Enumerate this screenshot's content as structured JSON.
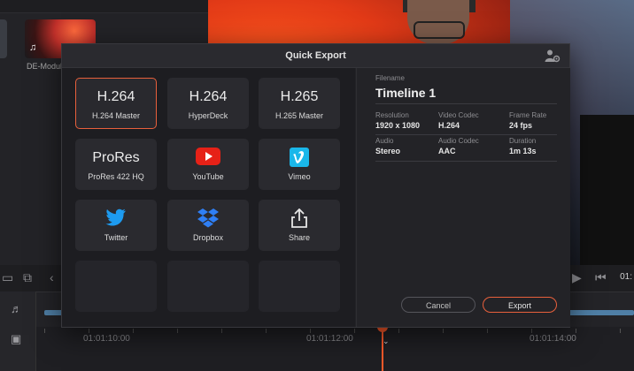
{
  "media_pool": {
    "clip_name": "DE-Modul"
  },
  "timeline": {
    "timecodes": [
      "01:01:10:00",
      "01:01:12:00",
      "01:01:14:00"
    ],
    "right_timecode": "01:"
  },
  "dialog": {
    "title": "Quick Export",
    "presets": [
      {
        "title": "H.264",
        "subtitle": "H.264 Master",
        "selected": true
      },
      {
        "title": "H.264",
        "subtitle": "HyperDeck"
      },
      {
        "title": "H.265",
        "subtitle": "H.265 Master"
      },
      {
        "title": "ProRes",
        "subtitle": "ProRes 422 HQ"
      },
      {
        "icon": "youtube-icon",
        "subtitle": "YouTube"
      },
      {
        "icon": "vimeo-icon",
        "subtitle": "Vimeo"
      },
      {
        "icon": "twitter-icon",
        "subtitle": "Twitter"
      },
      {
        "icon": "dropbox-icon",
        "subtitle": "Dropbox"
      },
      {
        "icon": "share-icon",
        "subtitle": "Share"
      }
    ],
    "filename_label": "Filename",
    "filename": "Timeline 1",
    "info": {
      "resolution_label": "Resolution",
      "resolution": "1920 x 1080",
      "video_codec_label": "Video Codec",
      "video_codec": "H.264",
      "frame_rate_label": "Frame Rate",
      "frame_rate": "24 fps",
      "audio_label": "Audio",
      "audio": "Stereo",
      "audio_codec_label": "Audio Codec",
      "audio_codec": "AAC",
      "duration_label": "Duration",
      "duration": "1m 13s"
    },
    "cancel_label": "Cancel",
    "export_label": "Export",
    "accent_color": "#e8603c"
  }
}
